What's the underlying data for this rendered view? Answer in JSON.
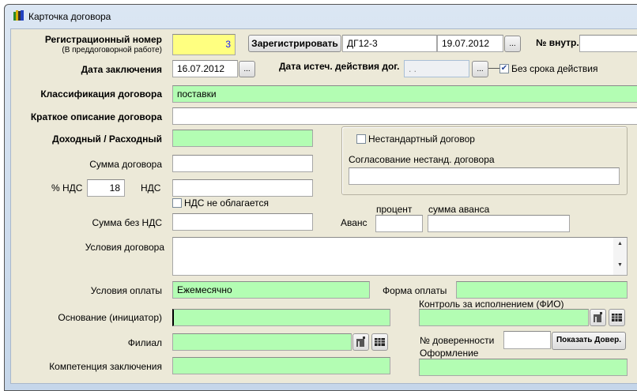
{
  "window": {
    "title": "Карточка договора"
  },
  "reg": {
    "label": "Регистрационный номер",
    "sublabel": "(В преддоговорной работе)",
    "value": "3",
    "register_button": "Зарегистрировать",
    "code": "ДГ12-3",
    "date": "19.07.2012",
    "internal_label": "№ внутр.",
    "internal_value": ""
  },
  "conclusion": {
    "label": "Дата заключения",
    "value": "16.07.2012"
  },
  "expiry": {
    "label": "Дата истеч. действия дог.",
    "value": " .  .",
    "no_term_label": "Без срока действия",
    "no_term_checked": true
  },
  "dots": "...",
  "classification": {
    "label": "Классификация договора",
    "value": "поставки"
  },
  "short_desc": {
    "label": "Краткое описание договора",
    "value": ""
  },
  "income": {
    "label": "Доходный / Расходный",
    "value": ""
  },
  "nonstandard": {
    "label": "Нестандартный договор",
    "checked": false,
    "approval_label": "Согласование нестанд. договора",
    "approval_value": ""
  },
  "sum": {
    "label": "Сумма договора",
    "value": ""
  },
  "vat": {
    "pct_label": "% НДС",
    "pct_value": "18",
    "label": "НДС",
    "value": "",
    "exempt_label": "НДС не облагается",
    "exempt_checked": false
  },
  "sum_no_vat": {
    "label": "Сумма без НДС",
    "value": ""
  },
  "advance": {
    "label": "Аванс",
    "percent_label": "процент",
    "percent_value": "",
    "amount_label": "сумма аванса",
    "amount_value": ""
  },
  "terms": {
    "label": "Условия договора",
    "value": ""
  },
  "payment_terms": {
    "label": "Условия оплаты",
    "value": "Ежемесячно"
  },
  "payment_form": {
    "label": "Форма оплаты",
    "value": ""
  },
  "basis": {
    "label": "Основание (инициатор)",
    "value": ""
  },
  "control": {
    "label": "Контроль за исполнением (ФИО)",
    "value": ""
  },
  "branch": {
    "label": "Филиал",
    "value": ""
  },
  "poa": {
    "label": "№ доверенности",
    "value": "",
    "button": "Показать Довер."
  },
  "registration": {
    "label": "Оформление",
    "value": ""
  },
  "competence": {
    "label": "Компетенция заключения",
    "value": ""
  }
}
